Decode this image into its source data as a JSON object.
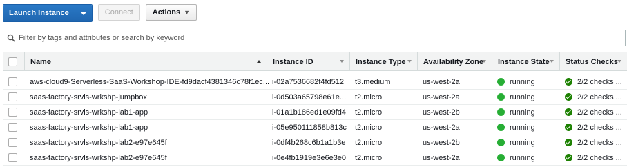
{
  "toolbar": {
    "launch_label": "Launch Instance",
    "connect_label": "Connect",
    "actions_label": "Actions"
  },
  "filter": {
    "placeholder": "Filter by tags and attributes or search by keyword"
  },
  "table": {
    "columns": [
      "Name",
      "Instance ID",
      "Instance Type",
      "Availability Zone",
      "Instance State",
      "Status Checks"
    ],
    "rows": [
      {
        "name": "aws-cloud9-Serverless-SaaS-Workshop-IDE-fd9dacf4381346c78f1ec...",
        "id": "i-02a7536682f4fd512",
        "type": "t3.medium",
        "zone": "us-west-2a",
        "state": "running",
        "checks": "2/2 checks ..."
      },
      {
        "name": "saas-factory-srvls-wrkshp-jumpbox",
        "id": "i-0d503a65798e61e...",
        "type": "t2.micro",
        "zone": "us-west-2a",
        "state": "running",
        "checks": "2/2 checks ..."
      },
      {
        "name": "saas-factory-srvls-wrkshp-lab1-app",
        "id": "i-01a1b186ed1e09fd4",
        "type": "t2.micro",
        "zone": "us-west-2b",
        "state": "running",
        "checks": "2/2 checks ..."
      },
      {
        "name": "saas-factory-srvls-wrkshp-lab1-app",
        "id": "i-05e950111858b813c",
        "type": "t2.micro",
        "zone": "us-west-2a",
        "state": "running",
        "checks": "2/2 checks ..."
      },
      {
        "name": "saas-factory-srvls-wrkshp-lab2-e97e645f",
        "id": "i-0df4b268c6b1a1b3e",
        "type": "t2.micro",
        "zone": "us-west-2b",
        "state": "running",
        "checks": "2/2 checks ..."
      },
      {
        "name": "saas-factory-srvls-wrkshp-lab2-e97e645f",
        "id": "i-0e4fb1919e3e6e3e0",
        "type": "t2.micro",
        "zone": "us-west-2a",
        "state": "running",
        "checks": "2/2 checks ..."
      }
    ]
  },
  "colors": {
    "primary": "#1f66b0",
    "running": "#27ae35",
    "check": "#1d8102"
  }
}
